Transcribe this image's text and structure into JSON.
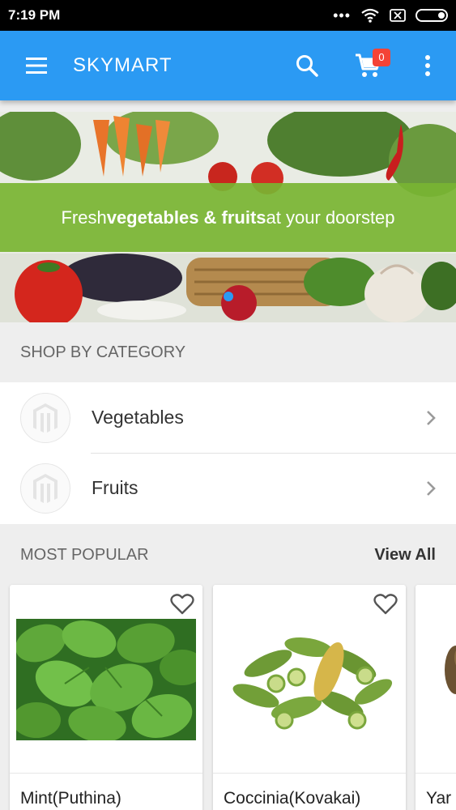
{
  "status_bar": {
    "time": "7:19 PM"
  },
  "app_bar": {
    "title": "SKYMART",
    "cart_count": "0"
  },
  "banner": {
    "text_prefix": "Fresh ",
    "text_bold": "vegetables & fruits",
    "text_suffix": " at your doorstep"
  },
  "categories": {
    "heading": "SHOP BY CATEGORY",
    "items": [
      {
        "label": "Vegetables"
      },
      {
        "label": "Fruits"
      }
    ]
  },
  "popular": {
    "heading": "MOST POPULAR",
    "view_all": "View All",
    "products": [
      {
        "name": "Mint(Puthina)"
      },
      {
        "name": "Coccinia(Kovakai)"
      },
      {
        "name": "Yar"
      }
    ]
  },
  "colors": {
    "primary": "#2b9af3",
    "banner_green": "#78b432",
    "badge": "#f44336"
  }
}
